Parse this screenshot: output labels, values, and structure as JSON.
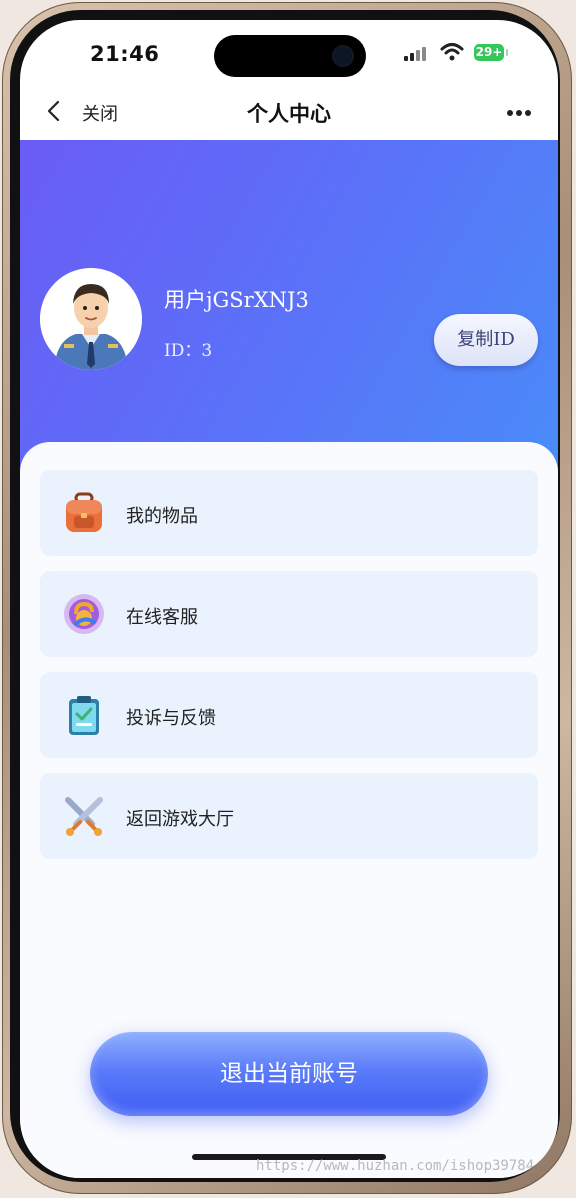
{
  "status_bar": {
    "time": "21:46",
    "battery": "29+"
  },
  "nav": {
    "close_label": "关闭",
    "title": "个人中心"
  },
  "profile": {
    "username": "用户jGSrXNJ3",
    "id_text": "ID：3",
    "copy_button_label": "复制ID"
  },
  "menu": [
    {
      "label": "我的物品",
      "icon": "backpack-icon"
    },
    {
      "label": "在线客服",
      "icon": "customer-service-icon"
    },
    {
      "label": "投诉与反馈",
      "icon": "clipboard-icon"
    },
    {
      "label": "返回游戏大厅",
      "icon": "crossed-swords-icon"
    }
  ],
  "logout_label": "退出当前账号",
  "watermark": "https://www.huzhan.com/ishop39784",
  "colors": {
    "header_gradient_start": "#6a5cf5",
    "header_gradient_end": "#4a8cf9",
    "menu_bg": "#eaf2fd",
    "logout_blue": "#3d5cf3"
  }
}
